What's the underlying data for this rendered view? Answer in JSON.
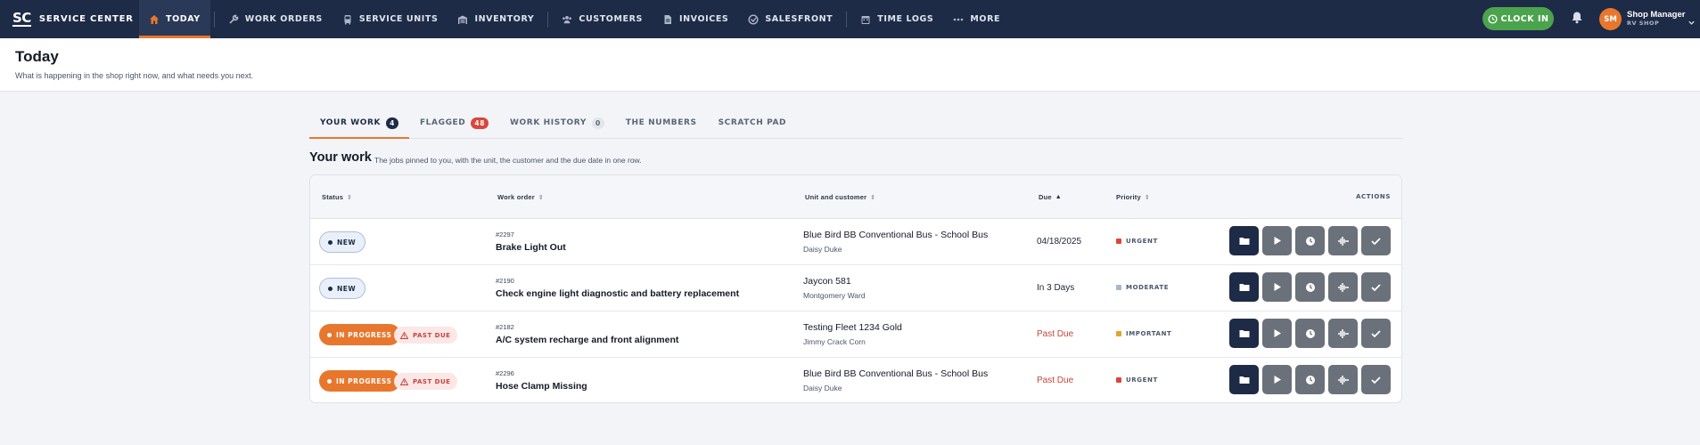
{
  "nav": {
    "logo": "SC",
    "brand": "SERVICE CENTER",
    "items": [
      {
        "label": "TODAY",
        "icon": "home-icon"
      },
      {
        "label": "WORK ORDERS",
        "icon": "wrench-icon"
      },
      {
        "label": "SERVICE UNITS",
        "icon": "bus-icon"
      },
      {
        "label": "INVENTORY",
        "icon": "warehouse-icon"
      },
      {
        "label": "CUSTOMERS",
        "icon": "users-icon"
      },
      {
        "label": "INVOICES",
        "icon": "file-icon"
      },
      {
        "label": "SALESFRONT",
        "icon": "store-icon"
      },
      {
        "label": "TIME LOGS",
        "icon": "calendar-icon"
      },
      {
        "label": "MORE",
        "icon": "more-icon"
      }
    ],
    "clock_in": "CLOCK IN",
    "avatar_initials": "SM",
    "user_name": "Shop Manager",
    "user_shop": "RV SHOP"
  },
  "header": {
    "title": "Today",
    "subtitle": "What is happening in the shop right now, and what needs you next."
  },
  "tabs": [
    {
      "label": "YOUR WORK",
      "badge": "4"
    },
    {
      "label": "FLAGGED",
      "badge": "48"
    },
    {
      "label": "WORK HISTORY",
      "badge": "0"
    },
    {
      "label": "THE NUMBERS",
      "badge": ""
    },
    {
      "label": "SCRATCH PAD",
      "badge": ""
    }
  ],
  "section": {
    "title": "Your work",
    "description": "The jobs pinned to you, with the unit, the customer and the due date in one row."
  },
  "table": {
    "columns": {
      "status": "Status",
      "work_order": "Work order",
      "unit": "Unit and customer",
      "due": "Due",
      "priority": "Priority",
      "actions": "ACTIONS"
    },
    "rows": [
      {
        "status": "NEW",
        "past_due_badge": "",
        "wo_number": "#2297",
        "wo_title": "Brake Light Out",
        "unit": "Blue Bird BB Conventional Bus - School Bus",
        "customer": "Daisy Duke",
        "due": "04/18/2025",
        "priority": "URGENT",
        "priority_color": "#d9473c"
      },
      {
        "status": "NEW",
        "past_due_badge": "",
        "wo_number": "#2190",
        "wo_title": "Check engine light diagnostic and battery replacement",
        "unit": "Jaycon 581",
        "customer": "Montgomery Ward",
        "due": "In 3 Days",
        "priority": "MODERATE",
        "priority_color": "#a9b6cc"
      },
      {
        "status": "IN PROGRESS",
        "past_due_badge": "PAST DUE",
        "wo_number": "#2182",
        "wo_title": "A/C system recharge and front alignment",
        "unit": "Testing Fleet 1234 Gold",
        "customer": "Jimmy Crack Corn",
        "due": "Past Due",
        "priority": "IMPORTANT",
        "priority_color": "#e0a52c"
      },
      {
        "status": "IN PROGRESS",
        "past_due_badge": "PAST DUE",
        "wo_number": "#2296",
        "wo_title": "Hose Clamp Missing",
        "unit": "Blue Bird BB Conventional Bus - School Bus",
        "customer": "Daisy Duke",
        "due": "Past Due",
        "priority": "URGENT",
        "priority_color": "#d9473c"
      }
    ]
  },
  "colors": {
    "nav_bg": "#1e2b47",
    "accent": "#e8772e",
    "clock_in": "#4ba34e",
    "past_due": "#c4453a"
  }
}
